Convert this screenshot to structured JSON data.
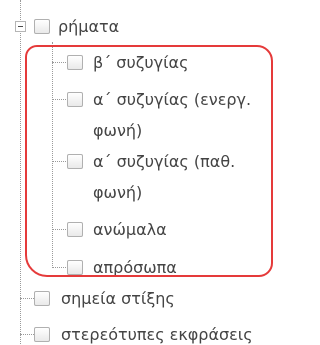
{
  "tree": {
    "root": {
      "label": "ρήματα",
      "expander_icon": "minus-expander-icon",
      "children": [
        {
          "label": "β΄ συζυγίας"
        },
        {
          "label": "α΄ συζυγίας (ενεργ.",
          "label_cont": "φωνή)"
        },
        {
          "label": "α΄ συζυγίας (παθ.",
          "label_cont": "φωνή)"
        },
        {
          "label": "ανώμαλα"
        },
        {
          "label": "απρόσωπα"
        }
      ]
    },
    "siblings": [
      {
        "label": "σημεία στίξης"
      },
      {
        "label": "στερεότυπες εκφράσεις"
      }
    ]
  },
  "annotation": {
    "color": "#e53a3a"
  }
}
